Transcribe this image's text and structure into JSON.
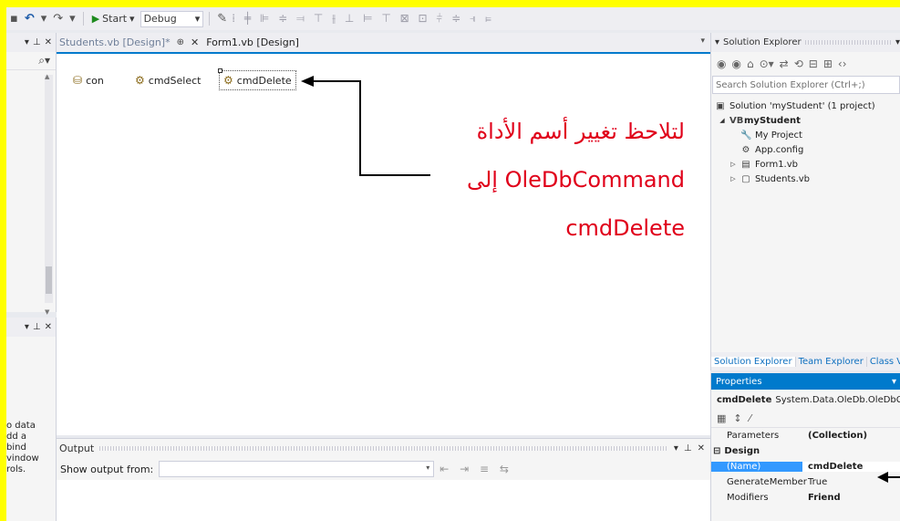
{
  "toolbar": {
    "redo_glyph": "↷",
    "start_label": "Start",
    "config_value": "Debug"
  },
  "doc_tabs": [
    {
      "label": "Students.vb [Design]*"
    },
    {
      "label": "Form1.vb [Design]"
    }
  ],
  "tray": {
    "components": [
      {
        "label": "con"
      },
      {
        "label": "cmdSelect"
      },
      {
        "label": "cmdDelete"
      }
    ]
  },
  "annotation": {
    "line1": "لتلاحظ تغيير أسم الأداة",
    "line2": "OleDbCommand إلى",
    "line3": "cmdDelete",
    "color": "#e0001a"
  },
  "left_panel": {
    "hint_lines": [
      "o data",
      "dd a",
      "bind",
      "vindow",
      "rols."
    ]
  },
  "output": {
    "title": "Output",
    "show_from_label": "Show output from:",
    "tool_icons": "⇤ ⇥ ≡ ⇆"
  },
  "solution_explorer": {
    "title": "Solution Explorer",
    "search_placeholder": "Search Solution Explorer (Ctrl+;)",
    "tree": [
      {
        "label": "Solution 'myStudent' (1 project)",
        "level": 0,
        "expander": "",
        "icon": "▣"
      },
      {
        "label": "myStudent",
        "level": 1,
        "expander": "◢",
        "icon": "VB",
        "bold": true
      },
      {
        "label": "My Project",
        "level": 2,
        "expander": "",
        "icon": "🔧"
      },
      {
        "label": "App.config",
        "level": 2,
        "expander": "",
        "icon": "⚙"
      },
      {
        "label": "Form1.vb",
        "level": 2,
        "expander": "▷",
        "icon": "▤"
      },
      {
        "label": "Students.vb",
        "level": 2,
        "expander": "▷",
        "icon": "▢"
      }
    ],
    "bottom_tabs": [
      "Solution Explorer",
      "Team Explorer",
      "Class V"
    ]
  },
  "properties": {
    "title": "Properties",
    "object_name": "cmdDelete",
    "object_type": "System.Data.OleDb.OleDbCo",
    "rows": [
      {
        "kind": "prop",
        "name": "Parameters",
        "value": "(Collection)",
        "bold": true
      },
      {
        "kind": "cat",
        "name": "Design"
      },
      {
        "kind": "prop",
        "name": "(Name)",
        "value": "cmdDelete",
        "bold": true,
        "selected": true
      },
      {
        "kind": "prop",
        "name": "GenerateMember",
        "value": "True",
        "bold": false
      },
      {
        "kind": "prop",
        "name": "Modifiers",
        "value": "Friend",
        "bold": true
      }
    ]
  }
}
